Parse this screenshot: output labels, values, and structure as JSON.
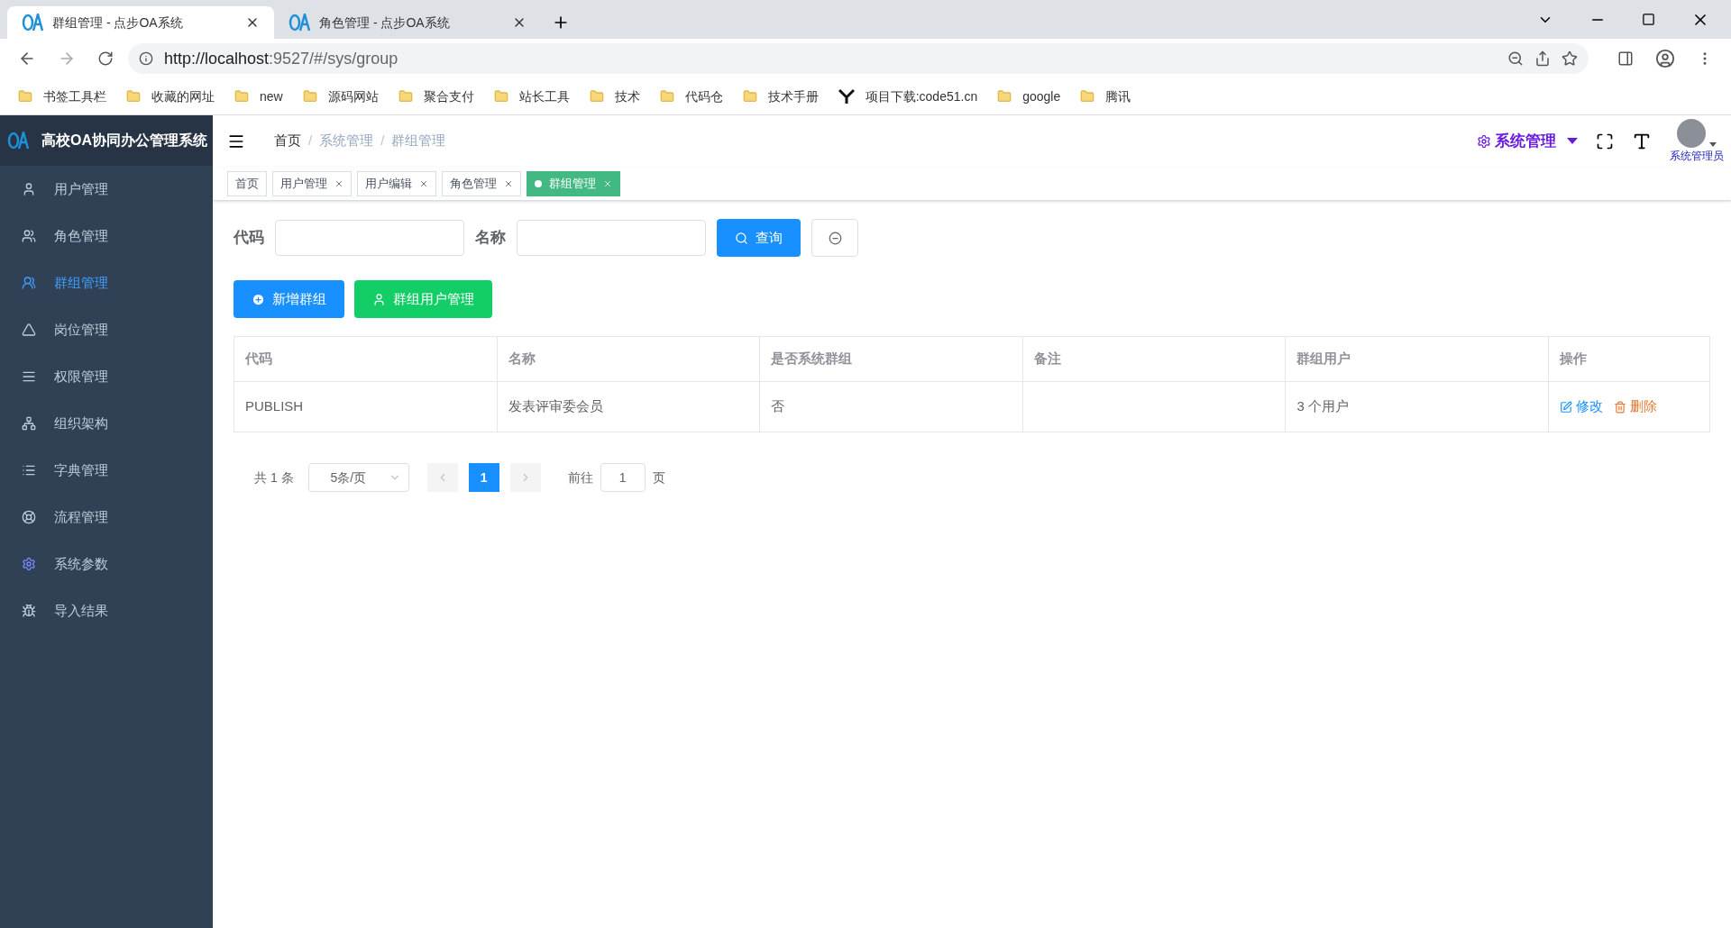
{
  "browser": {
    "tabs": [
      {
        "title": "群组管理 - 点步OA系统",
        "selected": true
      },
      {
        "title": "角色管理 - 点步OA系统",
        "selected": false
      }
    ],
    "url_host": "http://localhost",
    "url_rest": ":9527/#/sys/group",
    "bookmarks": [
      {
        "label": "书签工具栏",
        "kind": "folder"
      },
      {
        "label": "收藏的网址",
        "kind": "folder"
      },
      {
        "label": "new",
        "kind": "folder"
      },
      {
        "label": "源码网站",
        "kind": "folder"
      },
      {
        "label": "聚合支付",
        "kind": "folder"
      },
      {
        "label": "站长工具",
        "kind": "folder"
      },
      {
        "label": "技术",
        "kind": "folder"
      },
      {
        "label": "代码仓",
        "kind": "folder"
      },
      {
        "label": "技术手册",
        "kind": "folder"
      },
      {
        "label": "项目下载:code51.cn",
        "kind": "logo"
      },
      {
        "label": "google",
        "kind": "folder"
      },
      {
        "label": "腾讯",
        "kind": "folder"
      }
    ]
  },
  "app": {
    "title": "高校OA协同办公管理系统",
    "sidebar": {
      "items": [
        {
          "label": "用户管理",
          "selected": false
        },
        {
          "label": "角色管理",
          "selected": false
        },
        {
          "label": "群组管理",
          "selected": true
        },
        {
          "label": "岗位管理",
          "selected": false
        },
        {
          "label": "权限管理",
          "selected": false
        },
        {
          "label": "组织架构",
          "selected": false
        },
        {
          "label": "字典管理",
          "selected": false
        },
        {
          "label": "流程管理",
          "selected": false
        },
        {
          "label": "系统参数",
          "selected": false
        },
        {
          "label": "导入结果",
          "selected": false
        }
      ]
    },
    "breadcrumb": [
      {
        "text": "首页",
        "kind": "link"
      },
      {
        "text": "/",
        "kind": "separator"
      },
      {
        "text": "系统管理",
        "kind": "text"
      },
      {
        "text": "/",
        "kind": "separator"
      },
      {
        "text": "群组管理",
        "kind": "text"
      }
    ],
    "header_menu": "系统管理",
    "user_name": "系统管理员",
    "tags": [
      {
        "label": "首页",
        "closable": false,
        "selected": false
      },
      {
        "label": "用户管理",
        "closable": true,
        "selected": false
      },
      {
        "label": "用户编辑",
        "closable": true,
        "selected": false
      },
      {
        "label": "角色管理",
        "closable": true,
        "selected": false
      },
      {
        "label": "群组管理",
        "closable": true,
        "selected": true
      }
    ],
    "filters": [
      {
        "label": "代码"
      },
      {
        "label": "名称"
      }
    ],
    "query_button": "查询",
    "actions": [
      {
        "label": "新增群组",
        "kind": "primary"
      },
      {
        "label": "群组用户管理",
        "kind": "success"
      }
    ],
    "table": {
      "columns": [
        "代码",
        "名称",
        "是否系统群组",
        "备注",
        "群组用户",
        "操作"
      ],
      "rows": [
        {
          "cells": [
            "PUBLISH",
            "发表评审委会员",
            "否",
            "",
            "3 个用户"
          ],
          "edit": "修改",
          "delete": "删除"
        }
      ]
    },
    "pagination": {
      "total": "共 1 条",
      "page_size": "5条/页",
      "pages": [
        {
          "label": "1",
          "selected": true
        }
      ],
      "goto": "前往",
      "goto_value": "1",
      "suffix": "页"
    }
  }
}
